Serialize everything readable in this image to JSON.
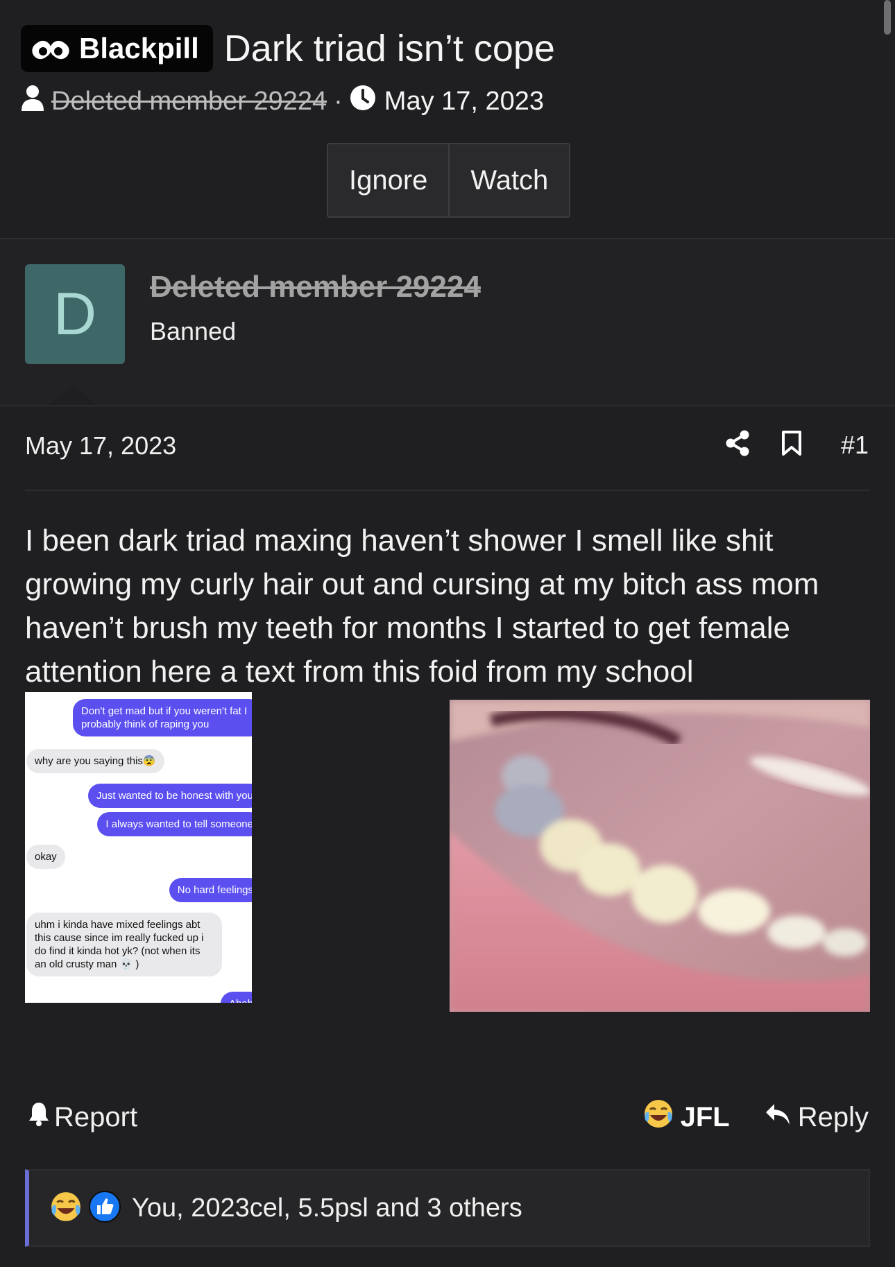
{
  "thread": {
    "prefix": "Blackpill",
    "title": "Dark triad isn’t cope",
    "author": "Deleted member 29224",
    "separator": "·",
    "date": "May 17, 2023"
  },
  "thread_buttons": {
    "ignore": "Ignore",
    "watch": "Watch"
  },
  "user": {
    "avatar_letter": "D",
    "name": "Deleted member 29224",
    "title": "Banned"
  },
  "post": {
    "date": "May 17, 2023",
    "number": "#1",
    "body": "I been dark triad maxing haven’t shower I smell like shit growing my curly hair out and cursing at my bitch ass mom haven’t brush my teeth for months I started to get female attention here a text from this foid from my school"
  },
  "chat": {
    "messages": [
      {
        "dir": "out",
        "text": "Don't get mad but if you weren't fat I probably think of raping you"
      },
      {
        "dir": "in",
        "text": "why are you saying this😨"
      },
      {
        "dir": "out",
        "text": "Just wanted to be honest with you"
      },
      {
        "dir": "out",
        "text": "I always wanted to tell someone"
      },
      {
        "dir": "in",
        "text": "okay"
      },
      {
        "dir": "out",
        "text": "No hard feelings"
      },
      {
        "dir": "in",
        "text": "uhm i kinda have mixed feelings abt this cause since im really fucked up i do find it kinda hot yk? (not when its an old crusty man 💀 )"
      },
      {
        "dir": "out",
        "text": "Ahah"
      }
    ]
  },
  "actions": {
    "report": "Report",
    "jfl": "JFL",
    "reply": "Reply"
  },
  "reactions": {
    "text": "You, 2023cel, 5.5psl and 3 others"
  },
  "colors": {
    "background": "#1f1f21",
    "accent": "#6a6fd6",
    "chat_out": "#5b4ff0",
    "avatar": "#3e6767"
  }
}
